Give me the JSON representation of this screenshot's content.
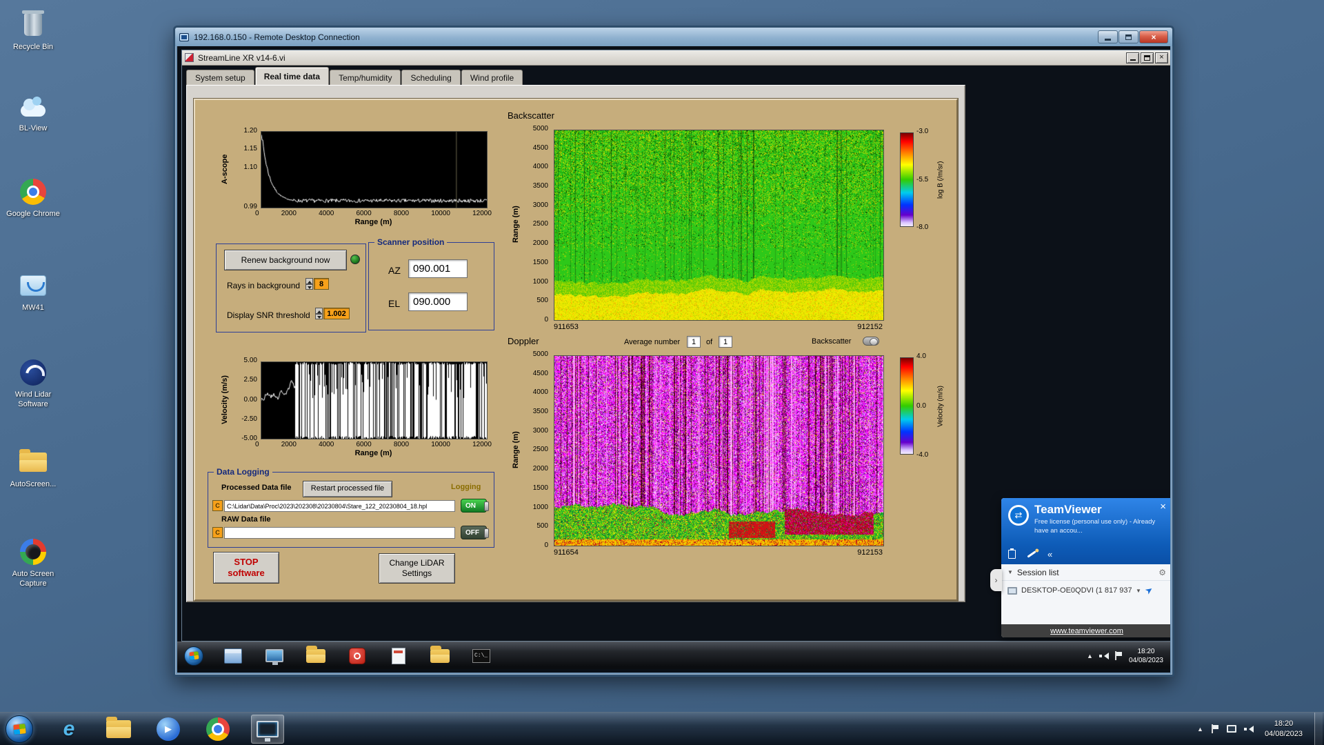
{
  "desktop_icons": [
    {
      "label": "Recycle Bin"
    },
    {
      "label": "BL-View"
    },
    {
      "label": "Google Chrome"
    },
    {
      "label": "MW41"
    },
    {
      "label": "Wind Lidar Software"
    },
    {
      "label": "AutoScreen..."
    },
    {
      "label": "Auto Screen Capture"
    }
  ],
  "rdp_window": {
    "title": "192.168.0.150 - Remote Desktop Connection"
  },
  "app_window": {
    "title": "StreamLine XR v14-6.vi",
    "tabs": [
      "System setup",
      "Real time data",
      "Temp/humidity",
      "Scheduling",
      "Wind profile"
    ]
  },
  "ascope": {
    "ylabel": "A-scope",
    "xlabel": "Range (m)",
    "yticks": [
      "1.20",
      "1.15",
      "1.10",
      "0.99"
    ],
    "xticks": [
      "0",
      "2000",
      "4000",
      "6000",
      "8000",
      "10000",
      "12000"
    ]
  },
  "background_controls": {
    "renew_button": "Renew background now",
    "rays_label": "Rays in background",
    "rays_value": "8",
    "snr_label": "Display SNR threshold",
    "snr_value": "1.002"
  },
  "scanner_position": {
    "title": "Scanner position",
    "az_label": "AZ",
    "az_value": "090.001",
    "el_label": "EL",
    "el_value": "090.000"
  },
  "backscatter_plot": {
    "title": "Backscatter",
    "ylabel": "Range (m)",
    "yticks": [
      "5000",
      "4500",
      "4000",
      "3500",
      "3000",
      "2500",
      "2000",
      "1500",
      "1000",
      "500",
      "0"
    ],
    "x_start": "911653",
    "x_end": "912152",
    "colorbar_label": "log B (/m/sr)",
    "colorbar_ticks": [
      "-3.0",
      "-5.5",
      "-8.0"
    ]
  },
  "doppler_plot": {
    "title": "Doppler",
    "average_label": "Average number",
    "average_value": "1",
    "of_label": "of",
    "average_total": "1",
    "backscatter_toggle_label": "Backscatter",
    "ylabel": "Range (m)",
    "yticks": [
      "5000",
      "4500",
      "4000",
      "3500",
      "3000",
      "2500",
      "2000",
      "1500",
      "1000",
      "500",
      "0"
    ],
    "x_start": "911654",
    "x_end": "912153",
    "colorbar_label": "Velocity (m/s)",
    "colorbar_ticks": [
      "4.0",
      "0.0",
      "-4.0"
    ]
  },
  "velocity_plot": {
    "ylabel": "Velocity (m/s)",
    "xlabel": "Range (m)",
    "yticks": [
      "5.00",
      "2.50",
      "0.00",
      "-2.50",
      "-5.00"
    ],
    "xticks": [
      "0",
      "2000",
      "4000",
      "6000",
      "8000",
      "10000",
      "12000"
    ]
  },
  "data_logging": {
    "title": "Data Logging",
    "processed_label": "Processed Data file",
    "restart_button": "Restart processed file",
    "logging_label": "Logging",
    "processed_path": "C:\\Lidar\\Data\\Proc\\2023\\202308\\20230804\\Stare_122_20230804_18.hpl",
    "on_label": "ON",
    "raw_label": "RAW Data file",
    "raw_path": "",
    "off_label": "OFF",
    "drive_letter": "C"
  },
  "action_buttons": {
    "stop": "STOP software",
    "change_settings": "Change LiDAR Settings"
  },
  "remote_taskbar": {
    "time": "18:20",
    "date": "04/08/2023",
    "cmd_icon_label": "C:\\_"
  },
  "teamviewer": {
    "title": "TeamViewer",
    "subtitle": "Free license (personal use only) - Already have an accou...",
    "session_list_label": "Session list",
    "session_entry": "DESKTOP-OE0QDVI (1 817 937",
    "footer_link": "www.teamviewer.com"
  },
  "host_taskbar": {
    "time": "18:20",
    "date": "04/08/2023"
  }
}
